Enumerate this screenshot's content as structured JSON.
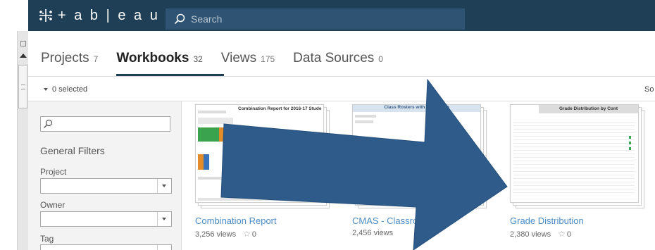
{
  "header": {
    "logo_text": "+ a b | e a u",
    "search_placeholder": "Search"
  },
  "tabs": [
    {
      "label": "Projects",
      "count": "7"
    },
    {
      "label": "Workbooks",
      "count": "32"
    },
    {
      "label": "Views",
      "count": "175"
    },
    {
      "label": "Data Sources",
      "count": "0"
    }
  ],
  "selection": {
    "label": "0 selected",
    "sort_label": "So"
  },
  "filters": {
    "title": "General Filters",
    "fields": [
      {
        "label": "Project"
      },
      {
        "label": "Owner"
      },
      {
        "label": "Tag"
      }
    ]
  },
  "workbooks": [
    {
      "title": "Combination Report",
      "views": "3,256 views",
      "favorites": "0",
      "thumb_title": "Combination Report for 2016-17 Stude"
    },
    {
      "title": "CMAS - Classroo",
      "views": "2,456 views",
      "favorites": "",
      "thumb_title": "Class Rosters with                rmance Le"
    },
    {
      "title": "Grade Distribution",
      "views": "2,380 views",
      "favorites": "0",
      "thumb_title": "Grade Distribution by Cont"
    }
  ],
  "icons": {
    "logo": "tableau-logo-icon",
    "search": "search-icon",
    "favorite": "star-outline-icon",
    "dropdown": "chevron-down-icon"
  },
  "colors": {
    "header_bg": "#1f3f57",
    "search_bg": "#2f5473",
    "link": "#4b8cc6",
    "arrow": "#2e5b8a"
  }
}
